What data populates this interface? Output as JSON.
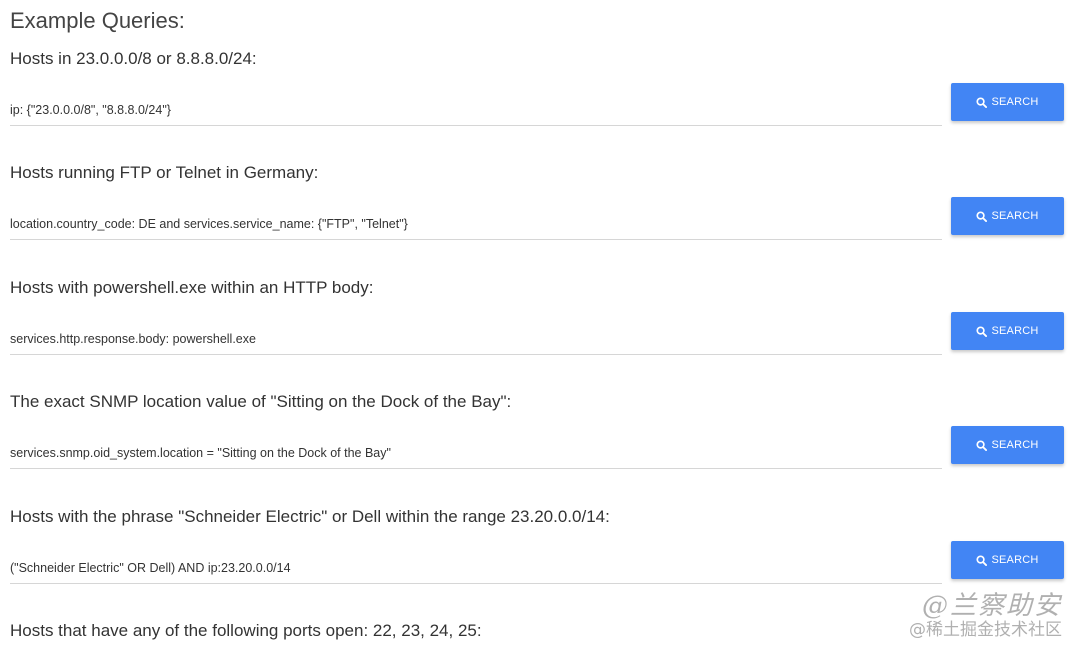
{
  "page": {
    "title": "Example Queries:"
  },
  "queries": [
    {
      "heading": "Hosts in 23.0.0.0/8 or 8.8.8.0/24:",
      "query": "ip: {\"23.0.0.0/8\", \"8.8.8.0/24\"}",
      "button_label": "SEARCH"
    },
    {
      "heading": "Hosts running FTP or Telnet in Germany:",
      "query": "location.country_code: DE and services.service_name: {\"FTP\", \"Telnet\"}",
      "button_label": "SEARCH"
    },
    {
      "heading": "Hosts with powershell.exe within an HTTP body:",
      "query": "services.http.response.body: powershell.exe",
      "button_label": "SEARCH"
    },
    {
      "heading": "The exact SNMP location value of \"Sitting on the Dock of the Bay\":",
      "query": "services.snmp.oid_system.location = \"Sitting on the Dock of the Bay\"",
      "button_label": "SEARCH"
    },
    {
      "heading": "Hosts with the phrase \"Schneider Electric\" or Dell within the range 23.20.0.0/14:",
      "query": "(\"Schneider Electric\" OR Dell) AND ip:23.20.0.0/14",
      "button_label": "SEARCH"
    },
    {
      "heading": "Hosts that have any of the following ports open: 22, 23, 24, 25:",
      "query": "",
      "button_label": ""
    }
  ],
  "watermark": {
    "line1": "@兰察助安",
    "line2": "@稀土掘金技术社区"
  },
  "colors": {
    "button_bg": "#4285f4",
    "button_text": "#ffffff",
    "field_underline": "#d6d6d6"
  },
  "icons": {
    "button_icon": "search-icon"
  }
}
